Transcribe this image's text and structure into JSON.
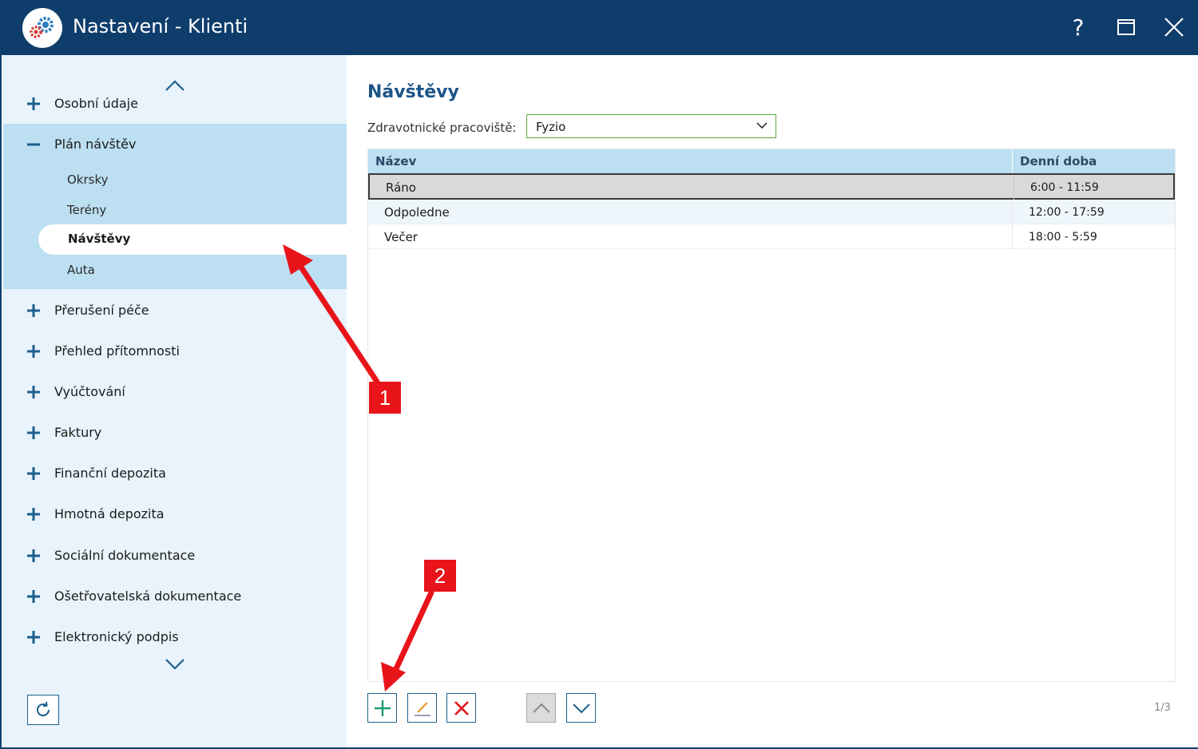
{
  "window": {
    "title": "Nastavení - Klienti",
    "help_label": "?"
  },
  "sidebar": {
    "items": [
      {
        "label": "Osobní údaje",
        "expanded": false
      },
      {
        "label": "Plán návštěv",
        "expanded": true
      },
      {
        "label": "Přerušení péče",
        "expanded": false
      },
      {
        "label": "Přehled přítomnosti",
        "expanded": false
      },
      {
        "label": "Vyúčtování",
        "expanded": false
      },
      {
        "label": "Faktury",
        "expanded": false
      },
      {
        "label": "Finanční depozita",
        "expanded": false
      },
      {
        "label": "Hmotná depozita",
        "expanded": false
      },
      {
        "label": "Sociální dokumentace",
        "expanded": false
      },
      {
        "label": "Ošetřovatelská dokumentace",
        "expanded": false
      },
      {
        "label": "Elektronický podpis",
        "expanded": false
      }
    ],
    "subitems": [
      "Okrsky",
      "Terény",
      "Návštěvy",
      "Auta"
    ],
    "active_subitem": "Návštěvy"
  },
  "main": {
    "title": "Návštěvy",
    "workplace_label": "Zdravotnické pracoviště:",
    "workplace_value": "Fyzio",
    "columns": [
      "Název",
      "Denní doba"
    ],
    "rows": [
      {
        "name": "Ráno",
        "time": "6:00 - 11:59",
        "selected": true
      },
      {
        "name": "Odpoledne",
        "time": "12:00 - 17:59",
        "selected": false
      },
      {
        "name": "Večer",
        "time": "18:00 - 5:59",
        "selected": false
      }
    ],
    "pager": "1/3"
  },
  "annotations": {
    "badge_1": "1",
    "badge_2": "2"
  },
  "colors": {
    "titlebar": "#0e3d6b",
    "sidebar_bg": "#e8f3fb",
    "sidebar_expanded": "#bcdff2",
    "accent": "#1b5488",
    "annotation": "#e8141a",
    "add_green": "#1a9a6e",
    "delete_red": "#e0161b"
  }
}
